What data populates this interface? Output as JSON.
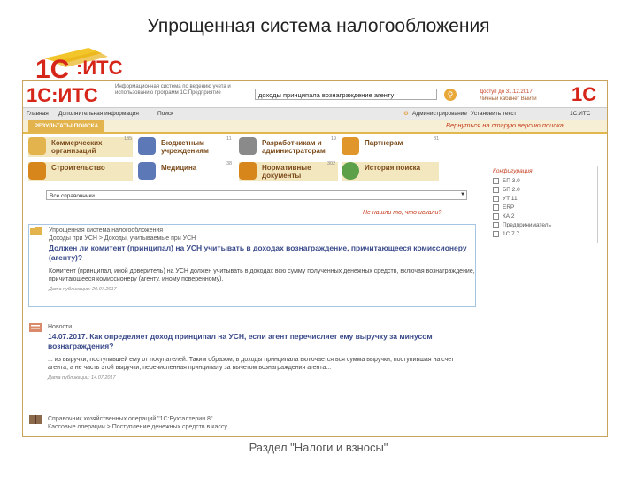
{
  "slide": {
    "title": "Упрощенная система налогообложения",
    "logo_text": "1С:ИТС",
    "footer": "Раздел \"Налоги и взносы\""
  },
  "header": {
    "logo_text": "1С:ИТС",
    "description": "Информационная система по ведению учета и использованию программ 1С:Предприятие",
    "search_value": "доходы принципала вознаграждение агенту",
    "access": "Доступ до 31.12.2017",
    "user_links": "Личный кабинет   Выйти",
    "logo2_text": "1С"
  },
  "menubar": {
    "items": [
      "Главная",
      "Дополнительная информация",
      "Поиск"
    ],
    "right_items": [
      "Администрирование",
      "Установить текст",
      "1С:ИТС"
    ]
  },
  "tabs": {
    "active": "РЕЗУЛЬТАТЫ ПОИСКА",
    "return_link": "Вернуться на старую версию поиска"
  },
  "categories": [
    {
      "label": "Коммерческих\nорганизаций",
      "count": "135"
    },
    {
      "label": "Бюджетным\nучреждениям",
      "count": "11"
    },
    {
      "label": "Разработчикам и\nадминистраторам",
      "count": "19"
    },
    {
      "label": "Партнерам",
      "count": "81"
    },
    {
      "label": "Строительство",
      "count": ""
    },
    {
      "label": "Медицина",
      "count": "38"
    },
    {
      "label": "Нормативные\nдокументы",
      "count": "302"
    },
    {
      "label": "История поиска",
      "count": ""
    }
  ],
  "config": {
    "title": "Конфигурация",
    "options": [
      "БП 3.0",
      "БП 2.0",
      "УТ 11",
      "ERP",
      "КА 2",
      "Предприниматель",
      "1С 7.7"
    ]
  },
  "filter": {
    "selected": "Все справочники",
    "noresult_link": "Не нашли то, что искали?"
  },
  "results": [
    {
      "source": "Упрощенная система налогообложения\nДоходы при УСН > Доходы, учитываемые при УСН",
      "title": "Должен ли комитент (принципал) на УСН учитывать в доходах вознаграждение, причитающееся комиссионеру (агенту)?",
      "snippet": "Комитент (принципал, иной доверитель) на УСН должен учитывать в доходах всю сумму полученных денежных средств, включая вознаграждение, причитающееся комиссионеру (агенту, иному поверенному).",
      "date": "Дата публикации: 20.07.2017"
    },
    {
      "source": "Новости",
      "title": "14.07.2017. Как определяет доход принципал на УСН, если агент перечисляет ему выручку за минусом вознаграждения?",
      "snippet": "... из выручки, поступившей ему от покупателей. Таким образом, в доходы принципала включается вся сумма выручки, поступившая на счет агента, а не часть этой выручки, перечисленная принципалу за вычетом вознаграждения агента...",
      "date": "Дата публикации: 14.07.2017"
    },
    {
      "source": "Справочник хозяйственных операций  \"1С:Бухгалтерии 8\"\nКассовые операции > Поступление денежных средств в кассу",
      "title": "",
      "snippet": "",
      "date": ""
    }
  ],
  "colors": {
    "accent_orange": "#e3b44e",
    "link_red": "#c43a1a",
    "title_blue": "#3a4a8a",
    "highlight_border": "#a6c4e4"
  }
}
